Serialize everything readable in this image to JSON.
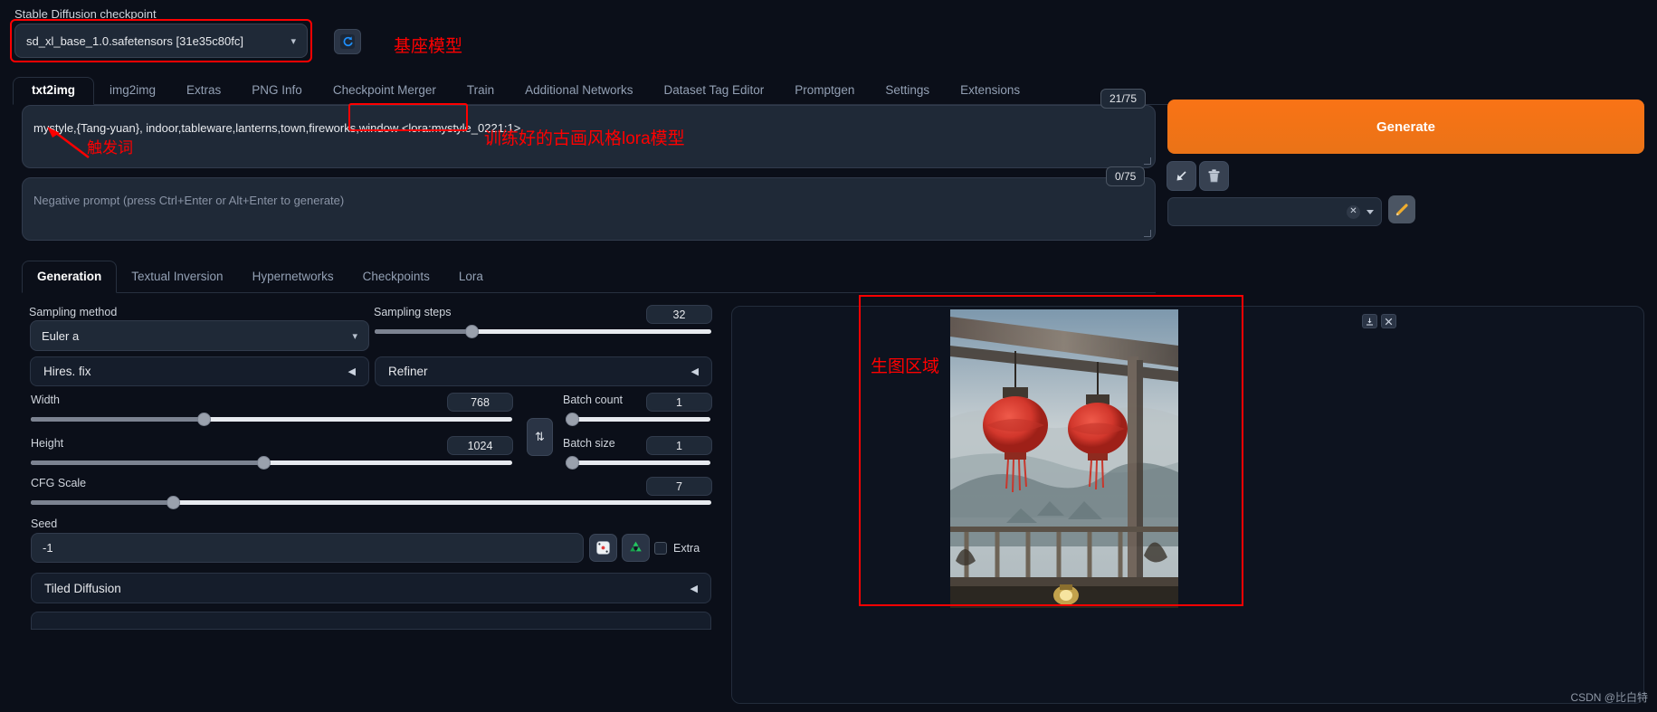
{
  "checkpoint": {
    "label": "Stable Diffusion checkpoint",
    "value": "sd_xl_base_1.0.safetensors [31e35c80fc]",
    "refresh_icon": "refresh-icon",
    "caret": "▾"
  },
  "tabs": [
    {
      "label": "txt2img",
      "active": true
    },
    {
      "label": "img2img",
      "active": false
    },
    {
      "label": "Extras",
      "active": false
    },
    {
      "label": "PNG Info",
      "active": false
    },
    {
      "label": "Checkpoint Merger",
      "active": false
    },
    {
      "label": "Train",
      "active": false
    },
    {
      "label": "Additional Networks",
      "active": false
    },
    {
      "label": "Dataset Tag Editor",
      "active": false
    },
    {
      "label": "Promptgen",
      "active": false
    },
    {
      "label": "Settings",
      "active": false
    },
    {
      "label": "Extensions",
      "active": false
    }
  ],
  "prompt": {
    "positive_value": "mystyle,{Tang-yuan}, indoor,tableware,lanterns,town,fireworks,window <lora:mystyle_0221:1>",
    "positive_head": "mystyle,{Tang-yuan}, indoor,tableware,lanterns,town,fireworks,window ",
    "lora_token": "<lora:mystyle_0221:1>",
    "negative_placeholder": "Negative prompt (press Ctrl+Enter or Alt+Enter to generate)",
    "token_count_positive": "21/75",
    "token_count_negative": "0/75"
  },
  "annotations": {
    "base_model": "基座模型",
    "trigger_word": "触发词",
    "lora_model": "训练好的古画风格lora模型",
    "gen_area": "生图区域",
    "color": "#ff0000"
  },
  "actions": {
    "generate_label": "Generate",
    "arrow_icon": "arrow-down-left-icon",
    "trash_icon": "trash-icon",
    "pencil_icon": "pencil-icon",
    "clear_icon": "✕",
    "styles_value": ""
  },
  "subtabs": [
    {
      "label": "Generation",
      "active": true
    },
    {
      "label": "Textual Inversion",
      "active": false
    },
    {
      "label": "Hypernetworks",
      "active": false
    },
    {
      "label": "Checkpoints",
      "active": false
    },
    {
      "label": "Lora",
      "active": false
    }
  ],
  "params": {
    "sampling_method_label": "Sampling method",
    "sampling_method_value": "Euler a",
    "sampling_steps_label": "Sampling steps",
    "sampling_steps_value": "32",
    "hires_fix_label": "Hires. fix",
    "refiner_label": "Refiner",
    "width_label": "Width",
    "width_value": "768",
    "height_label": "Height",
    "height_value": "1024",
    "batch_count_label": "Batch count",
    "batch_count_value": "1",
    "batch_size_label": "Batch size",
    "batch_size_value": "1",
    "cfg_scale_label": "CFG Scale",
    "cfg_scale_value": "7",
    "seed_label": "Seed",
    "seed_value": "-1",
    "extra_label": "Extra",
    "tiled_diffusion_label": "Tiled Diffusion",
    "swap_icon": "swap-arrows-icon",
    "dice_icon": "dice-icon",
    "recycle_icon": "recycle-icon",
    "collapse_caret": "◀"
  },
  "output": {
    "download_icon": "download-icon",
    "close_icon": "close-icon"
  },
  "watermark": "CSDN @比白特"
}
